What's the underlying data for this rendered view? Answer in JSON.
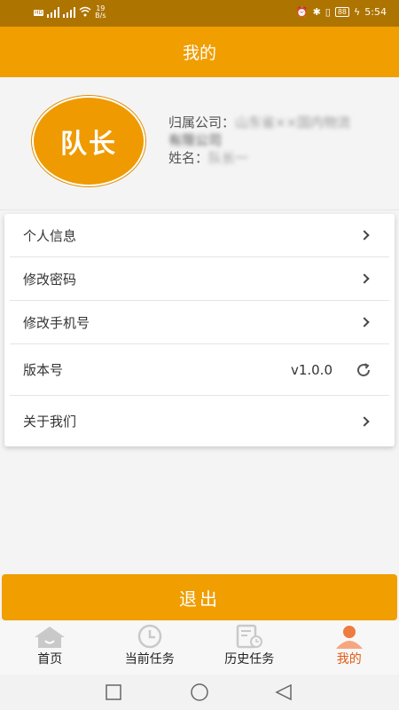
{
  "status_bar": {
    "speed_value": "19",
    "speed_unit": "B/s",
    "battery": "88",
    "time": "5:54"
  },
  "header": {
    "title": "我的"
  },
  "profile": {
    "avatar_text": "队长",
    "company_label": "归属公司：",
    "company_value": "山东省××国内物流",
    "company_value_2": "有限公司",
    "name_label": "姓名：",
    "name_value": "队长一"
  },
  "menu": {
    "items": [
      {
        "label": "个人信息"
      },
      {
        "label": "修改密码"
      },
      {
        "label": "修改手机号"
      },
      {
        "label": "版本号",
        "value": "v1.0.0"
      },
      {
        "label": "关于我们"
      }
    ]
  },
  "logout": {
    "label": "退出"
  },
  "tabbar": {
    "items": [
      {
        "label": "首页",
        "icon": "home-icon"
      },
      {
        "label": "当前任务",
        "icon": "clock-icon"
      },
      {
        "label": "历史任务",
        "icon": "history-document-icon"
      },
      {
        "label": "我的",
        "icon": "person-icon",
        "active": true
      }
    ]
  },
  "colors": {
    "primary": "#f09e00",
    "status_bar": "#ae7400",
    "active_tab": "#e35a12"
  }
}
